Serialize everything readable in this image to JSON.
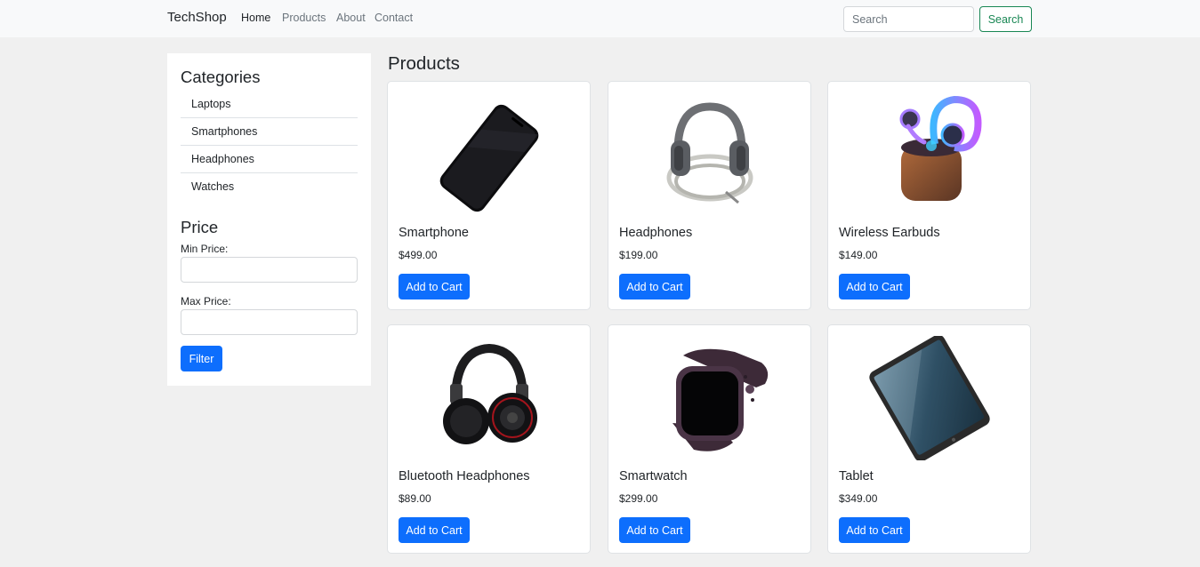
{
  "navbar": {
    "brand": "TechShop",
    "links": [
      "Home",
      "Products",
      "About",
      "Contact"
    ],
    "search_placeholder": "Search",
    "search_button": "Search"
  },
  "sidebar": {
    "categories_title": "Categories",
    "categories": [
      "Laptops",
      "Smartphones",
      "Headphones",
      "Watches"
    ],
    "price_title": "Price",
    "min_label": "Min Price:",
    "max_label": "Max Price:",
    "filter_button": "Filter"
  },
  "main": {
    "title": "Products",
    "products": [
      {
        "name": "Smartphone",
        "price": "$499.00",
        "button": "Add to Cart",
        "icon": "smartphone-image"
      },
      {
        "name": "Headphones",
        "price": "$199.00",
        "button": "Add to Cart",
        "icon": "headphones-image"
      },
      {
        "name": "Wireless Earbuds",
        "price": "$149.00",
        "button": "Add to Cart",
        "icon": "earbuds-image"
      },
      {
        "name": "Bluetooth Headphones",
        "price": "$89.00",
        "button": "Add to Cart",
        "icon": "bluetooth-headphones-image"
      },
      {
        "name": "Smartwatch",
        "price": "$299.00",
        "button": "Add to Cart",
        "icon": "smartwatch-image"
      },
      {
        "name": "Tablet",
        "price": "$349.00",
        "button": "Add to Cart",
        "icon": "tablet-image"
      }
    ]
  },
  "colors": {
    "primary": "#0d6efd",
    "success": "#198754",
    "navbar_bg": "#f8f9fa",
    "page_bg": "#f0f0f0"
  }
}
